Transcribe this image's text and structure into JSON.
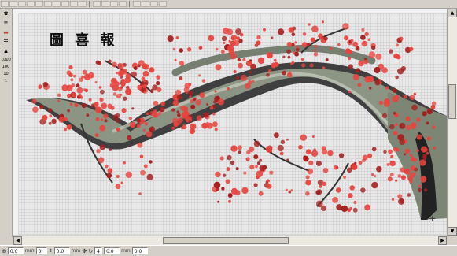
{
  "toolbar": {
    "icons": [
      "new-file",
      "open",
      "save",
      "print",
      "cut",
      "copy",
      "paste",
      "undo",
      "redo",
      "zoom",
      "select",
      "pencil",
      "fill",
      "text",
      "pointer",
      "grid",
      "color",
      "measure"
    ]
  },
  "palette": {
    "labels": [
      "1000",
      "100",
      "10",
      "1"
    ]
  },
  "canvas": {
    "calligraphy": "圖 喜 報",
    "crosshair": "+"
  },
  "statusbar": {
    "fields": [
      {
        "label": "",
        "value": "0.0"
      },
      {
        "label": "mm",
        "value": "0"
      },
      {
        "label": "↕",
        "value": "0.0"
      },
      {
        "label": "mm",
        "value": ""
      },
      {
        "label": "",
        "value": "4"
      },
      {
        "label": "",
        "value": "0.0"
      },
      {
        "label": "mm",
        "value": "0.0"
      }
    ]
  },
  "colors": {
    "blossom": "#e8443e",
    "blossom_dark": "#a51f1f",
    "branch": "#8a9280",
    "branch_dark": "#2b2b2b",
    "canvas": "#e8e8e8"
  }
}
